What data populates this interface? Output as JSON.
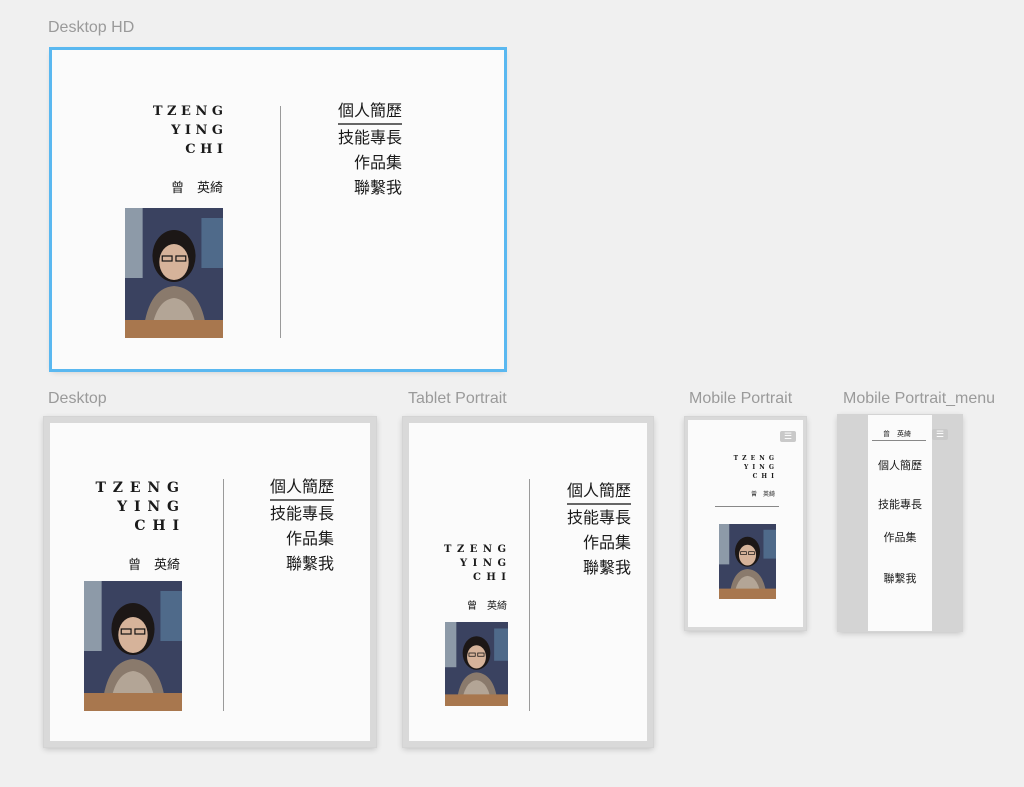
{
  "artboards": {
    "desktop_hd": {
      "label": "Desktop HD"
    },
    "desktop": {
      "label": "Desktop"
    },
    "tablet_portrait": {
      "label": "Tablet Portrait"
    },
    "mobile_portrait": {
      "label": "Mobile Portrait"
    },
    "mobile_portrait_menu": {
      "label": "Mobile Portrait_menu"
    }
  },
  "profile": {
    "name_line1": "T Z E N G",
    "name_line2": "Y I N G",
    "name_line3": "C H I",
    "chinese_name": "曾　英綺",
    "photo_icon": "portrait-photo"
  },
  "nav": {
    "resume": "個人簡歷",
    "skills": "技能專長",
    "portfolio": "作品集",
    "contact": "聯繫我"
  },
  "menu_button": {
    "icon": "hamburger-icon",
    "glyph": "☰"
  },
  "colors": {
    "canvas": "#f0f0f0",
    "artboard": "#fbfbfb",
    "selection": "#5ab8f0",
    "text": "#1a1a1a"
  }
}
